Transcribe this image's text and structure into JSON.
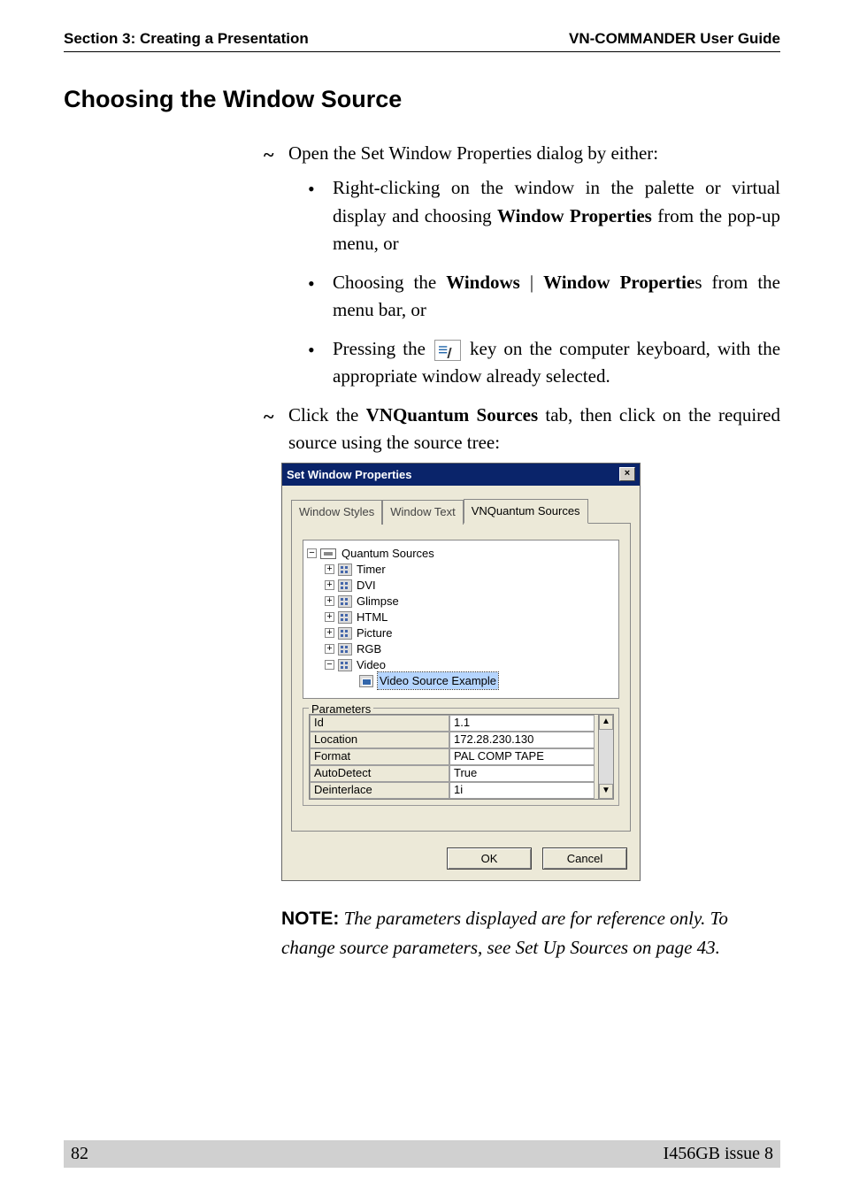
{
  "header": {
    "left": "Section 3: Creating a Presentation",
    "right": "VN-COMMANDER User Guide"
  },
  "title": "Choosing the Window Source",
  "steps": {
    "open": "Open the Set Window Properties dialog by either:",
    "bullets": {
      "b1_pre": "Right-clicking on the window in the palette or virtual display and choosing ",
      "b1_bold": "Window Properties",
      "b1_post": " from the pop-up menu, or",
      "b2_pre": "Choosing the ",
      "b2_bold1": "Windows",
      "b2_sep": " | ",
      "b2_bold2": "Window Propertie",
      "b2_post": "s from the menu bar, or",
      "b3_pre": "Pressing the ",
      "b3_post": " key on the computer keyboard, with the appropriate window already selected."
    },
    "click_pre": "Click the ",
    "click_bold": "VNQuantum Sources",
    "click_post": " tab, then click on the required source using the source tree:"
  },
  "dialog": {
    "title": "Set Window Properties",
    "tabs": {
      "styles": "Window Styles",
      "text": "Window Text",
      "sources": "VNQuantum Sources"
    },
    "tree": {
      "root": "Quantum Sources",
      "items": [
        "Timer",
        "DVI",
        "Glimpse",
        "HTML",
        "Picture",
        "RGB",
        "Video"
      ],
      "selected": "Video Source Example"
    },
    "paramsLabel": "Parameters",
    "params": [
      {
        "key": "Id",
        "val": "1.1"
      },
      {
        "key": "Location",
        "val": "172.28.230.130"
      },
      {
        "key": "Format",
        "val": "PAL COMP TAPE"
      },
      {
        "key": "AutoDetect",
        "val": "True"
      },
      {
        "key": "Deinterlace",
        "val": "1i"
      }
    ],
    "ok": "OK",
    "cancel": "Cancel"
  },
  "note": {
    "label": "NOTE:",
    "text": " The parameters displayed are for reference only. To change source parameters, see Set Up Sources on page 43."
  },
  "footer": {
    "page": "82",
    "issue": "I456GB issue 8"
  }
}
